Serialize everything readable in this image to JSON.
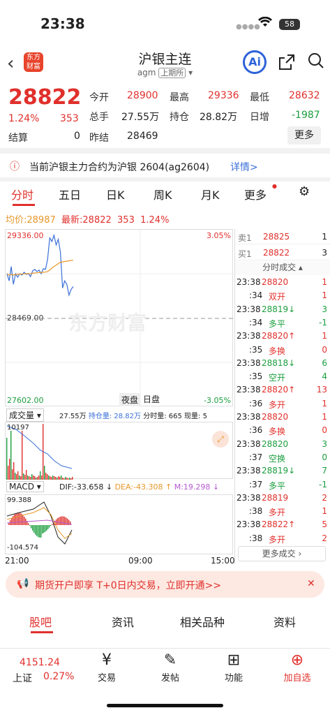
{
  "status": {
    "time": "23:38",
    "battery": "58"
  },
  "header": {
    "title": "沪银主连",
    "code": "agm",
    "exchange": "上期所",
    "logo": "东方财富"
  },
  "quote": {
    "price": "28822",
    "pct": "1.24%",
    "chg": "353",
    "open_label": "今开",
    "open": "28900",
    "high_label": "最高",
    "high": "29336",
    "low_label": "最低",
    "low": "28632",
    "vol_label": "总手",
    "vol": "27.55万",
    "oi_label": "持仓",
    "oi": "28.82万",
    "oi_chg_label": "日增",
    "oi_chg": "-1987",
    "settle_label": "结算",
    "settle": "0",
    "prev_label": "昨结",
    "prev": "28469",
    "more": "更多"
  },
  "notice": {
    "text": "当前沪银主力合约为沪银 2604(ag2604)",
    "link": "详情>"
  },
  "tabs": [
    "分时",
    "五日",
    "日K",
    "周K",
    "月K",
    "更多"
  ],
  "avgline": {
    "avg_label": "均价:",
    "avg": "28987",
    "last_label": "最新:",
    "last": "28822",
    "chg": "353",
    "pct": "1.24%"
  },
  "chart": {
    "hi": "29336.00",
    "mid": "28469.00",
    "lo": "27602.00",
    "hi_pct": "3.05%",
    "lo_pct": "-3.05%",
    "night": "夜盘",
    "day": "日盘",
    "watermark": "东方财富",
    "vol_sel": "成交量",
    "vol_text": "27.55万",
    "oi_text": "持仓量: 28.82万",
    "min_text": "分时量: 665",
    "cur_text": "现量: 5",
    "vol_max": "10197",
    "macd_sel": "MACD",
    "dif": "DIF:-33.658",
    "dea": "DEA:-43.308",
    "m": "M:19.298",
    "macd_hi": "99.388",
    "macd_lo": "-104.574",
    "t0": "21:00",
    "t1": "09:00",
    "t2": "15:00"
  },
  "chart_data": {
    "type": "line",
    "title": "",
    "xlabel": "",
    "ylabel": "",
    "ylim": [
      27602,
      29336
    ],
    "series": [
      {
        "name": "价格",
        "values": [
          28800,
          28700,
          28900,
          28650,
          28800,
          28750,
          28800,
          28780,
          28820,
          28790,
          28800,
          28760,
          28840,
          28860,
          28830,
          28850,
          28800,
          28870,
          28860,
          29000,
          29300,
          29250,
          29336,
          29200,
          29280,
          29100,
          28600,
          28700,
          28650,
          28500,
          28580,
          28620
        ]
      },
      {
        "name": "均价",
        "values": [
          28800,
          28780,
          28790,
          28780,
          28790,
          28790,
          28795,
          28795,
          28798,
          28800,
          28800,
          28800,
          28805,
          28810,
          28812,
          28815,
          28815,
          28820,
          28822,
          28830,
          28850,
          28880,
          28900,
          28920,
          28940,
          28960,
          28965,
          28970,
          28975,
          28980,
          28985,
          28987
        ]
      }
    ]
  },
  "orderbook": {
    "sell_label": "卖1",
    "sell_price": "28825",
    "sell_qty": "1",
    "buy_label": "买1",
    "buy_price": "28822",
    "buy_qty": "3",
    "ticks_title": "分时成交",
    "ticks": [
      [
        "23:38",
        "28820",
        "1",
        "red"
      ],
      [
        ":34",
        "双开",
        "1",
        "red"
      ],
      [
        "23:38",
        "28819↓",
        "3",
        "green"
      ],
      [
        ":34",
        "多平",
        "-1",
        "green"
      ],
      [
        "23:38",
        "28820↑",
        "1",
        "red"
      ],
      [
        ":35",
        "多换",
        "0",
        "red"
      ],
      [
        "23:38",
        "28818↓",
        "6",
        "green"
      ],
      [
        ":35",
        "空开",
        "4",
        "green"
      ],
      [
        "23:38",
        "28820↑",
        "13",
        "red"
      ],
      [
        ":36",
        "多开",
        "1",
        "red"
      ],
      [
        "23:38",
        "28820",
        "1",
        "red"
      ],
      [
        ":36",
        "多换",
        "0",
        "red"
      ],
      [
        "23:38",
        "28820",
        "3",
        "green"
      ],
      [
        ":37",
        "空换",
        "0",
        "green"
      ],
      [
        "23:38",
        "28819↓",
        "7",
        "green"
      ],
      [
        ":37",
        "多平",
        "-1",
        "green"
      ],
      [
        "23:38",
        "28819",
        "2",
        "red"
      ],
      [
        ":38",
        "多开",
        "1",
        "red"
      ],
      [
        "23:38",
        "28822↑",
        "5",
        "red"
      ],
      [
        ":38",
        "多开",
        "2",
        "red"
      ]
    ],
    "more": "更多成交"
  },
  "promo": {
    "text": "期货开户即享 T+0日内交易，立即开通>>"
  },
  "btabs": [
    "股吧",
    "资讯",
    "相关品种",
    "资料"
  ],
  "bottom": {
    "index_val": "4151.24",
    "index_name": "上证",
    "index_pct": "0.27%",
    "b1": "交易",
    "b2": "发帖",
    "b3": "功能",
    "b4": "加自选"
  }
}
